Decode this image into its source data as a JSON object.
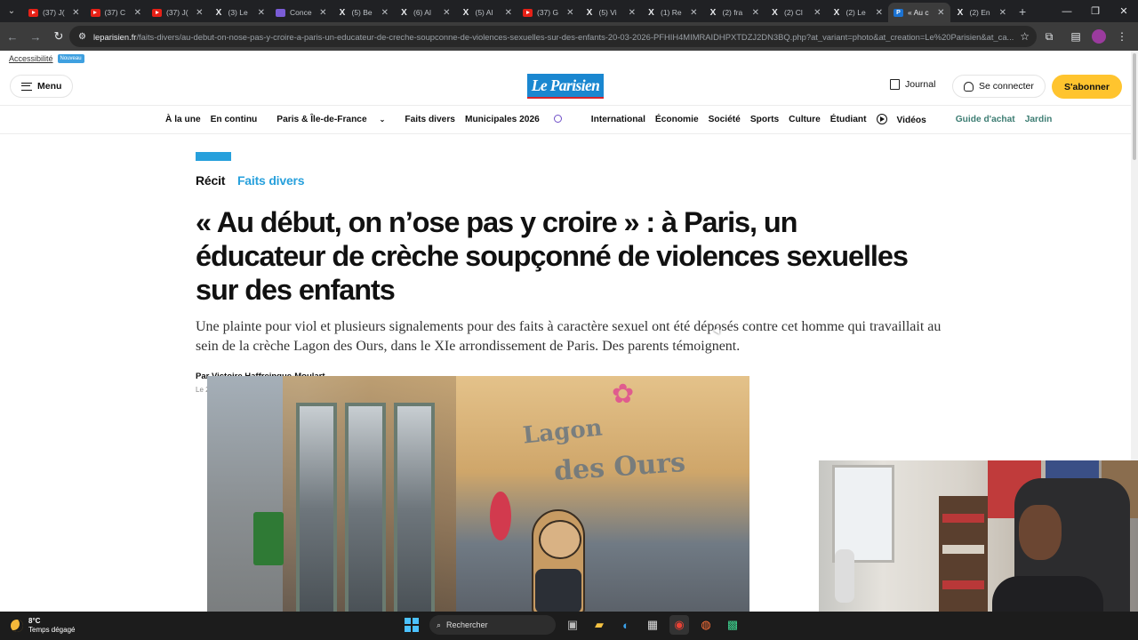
{
  "browser": {
    "tabs": [
      {
        "label": "(37) J(",
        "icon": "youtube-icon"
      },
      {
        "label": "(37) C",
        "icon": "youtube-icon"
      },
      {
        "label": "(37) J(",
        "icon": "youtube-icon"
      },
      {
        "label": "(3) Le",
        "icon": "x-icon"
      },
      {
        "label": "Conce",
        "icon": "extension-icon"
      },
      {
        "label": "(5) Be",
        "icon": "x-icon"
      },
      {
        "label": "(6) Al",
        "icon": "x-icon"
      },
      {
        "label": "(5) Al",
        "icon": "x-icon"
      },
      {
        "label": "(37) G",
        "icon": "youtube-icon"
      },
      {
        "label": "(5) Vi",
        "icon": "x-icon"
      },
      {
        "label": "(1) Re",
        "icon": "x-icon"
      },
      {
        "label": "(2) fra",
        "icon": "x-icon"
      },
      {
        "label": "(2) Cl",
        "icon": "x-icon"
      },
      {
        "label": "(2) Le",
        "icon": "x-icon"
      },
      {
        "label": "« Au c",
        "icon": "le-parisien-icon",
        "active": true
      },
      {
        "label": "(2) En",
        "icon": "x-icon"
      }
    ],
    "url_domain": "leparisien.fr",
    "url_path": "/faits-divers/au-debut-on-nose-pas-y-croire-a-paris-un-educateur-de-creche-soupconne-de-violences-sexuelles-sur-des-enfants-20-03-2026-PFHIH4MIMRAIDHPXTDZJ2DN3BQ.php?at_variant=photo&at_creation=Le%20Parisien&at_ca..."
  },
  "site": {
    "accessibility_link": "Accessibilité",
    "accessibility_badge": "Nouveau",
    "menu_label": "Menu",
    "logo_text": "Le Parisien",
    "journal_label": "Journal",
    "login_label": "Se connecter",
    "subscribe_label": "S'abonner",
    "nav": [
      "À la une",
      "En continu",
      "Paris & Île-de-France",
      "Faits divers",
      "Municipales 2026",
      "International",
      "Économie",
      "Société",
      "Sports",
      "Culture",
      "Étudiant",
      "Vidéos",
      "Guide d'achat",
      "Jardin"
    ]
  },
  "article": {
    "kicker_type": "Récit",
    "kicker_section": "Faits divers",
    "headline": "« Au début, on n’ose pas y croire » : à Paris, un éducateur de crèche soupçonné de violences sexuelles sur des enfants",
    "lede": "Une plainte pour viol et plusieurs signalements pour des faits à caractère sexuel ont été déposés contre cet homme qui travaillait au sein de la crèche Lagon des Ours, dans le XIe arrondissement de Paris. Des parents témoignent.",
    "byline_prefix": "Par",
    "author": "Victoire Haffreingue-Moulart",
    "date": "Le 20 mars 2026 à 20h41",
    "photo_sign_line1": "Lagon",
    "photo_sign_line2": "des Ours"
  },
  "taskbar": {
    "temperature": "8°C",
    "weather": "Temps dégagé",
    "search_placeholder": "Rechercher"
  },
  "colors": {
    "brand_blue": "#1a87d0",
    "section_blue": "#27a0dc",
    "subscribe_yellow": "#ffc42e",
    "nav_green": "#3d7d73"
  }
}
